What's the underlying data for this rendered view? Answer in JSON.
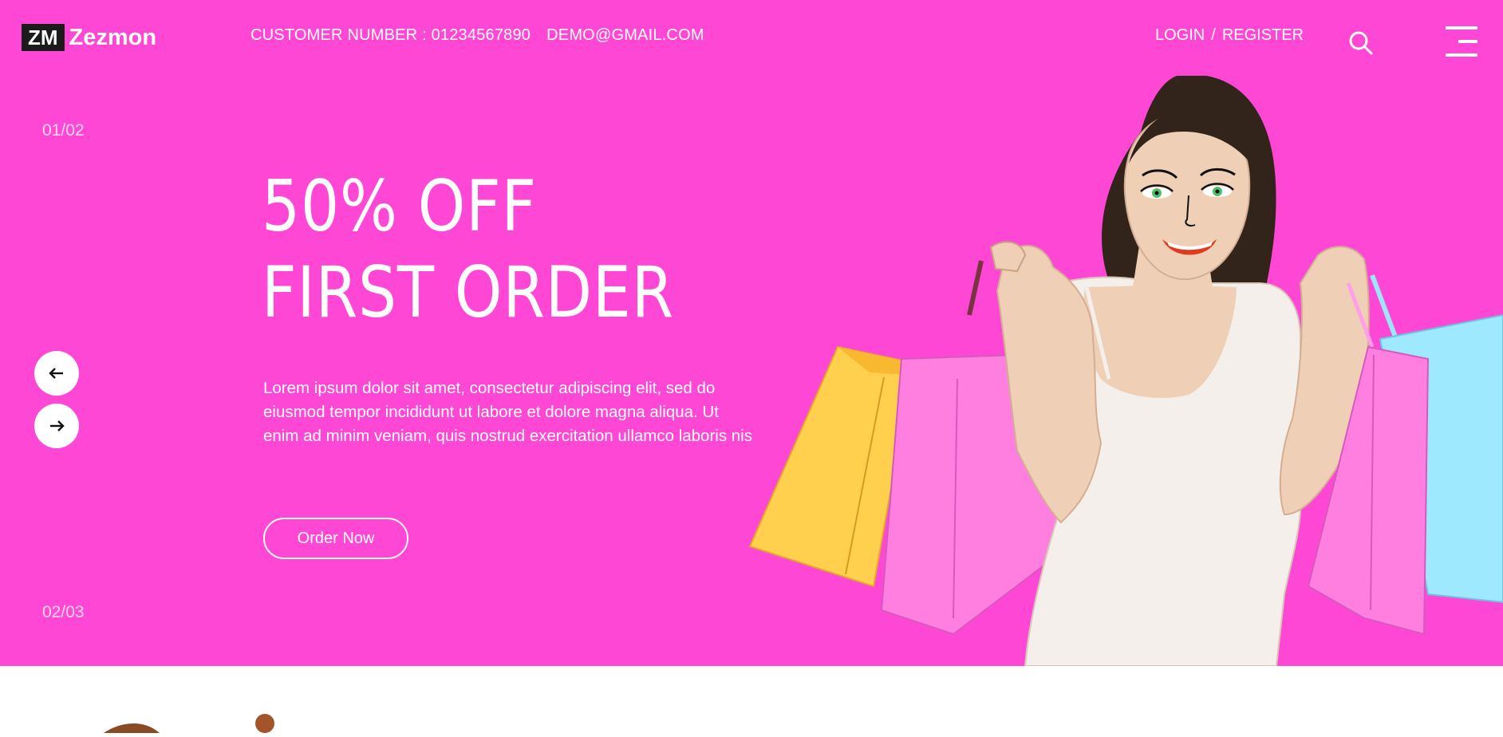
{
  "header": {
    "logo_mark": "ZM",
    "logo_name": "Zezmon",
    "customer_number": "CUSTOMER NUMBER : 01234567890",
    "email": "DEMO@GMAIL.COM",
    "login_label": "LOGIN",
    "separator": "/",
    "register_label": "REGISTER",
    "search_icon": "search-icon",
    "menu_icon": "hamburger-menu-icon"
  },
  "slider": {
    "current_index": "01/02",
    "next_index": "02/03",
    "prev_icon": "arrow-left-icon",
    "next_icon": "arrow-right-icon"
  },
  "hero": {
    "headline_line1": "50% OFF",
    "headline_line2": "FIRST ORDER",
    "description": "Lorem ipsum dolor sit amet, consectetur adipiscing elit, sed do eiusmod tempor incididunt ut labore et dolore magna aliqua. Ut enim ad minim veniam, quis nostrud exercitation ullamco laboris nis",
    "cta_label": "Order Now",
    "illustration": "woman-with-shopping-bags"
  },
  "colors": {
    "hero_background": "#ff47d6",
    "logo_box": "#1b1b1b",
    "text": "#ffffff"
  }
}
